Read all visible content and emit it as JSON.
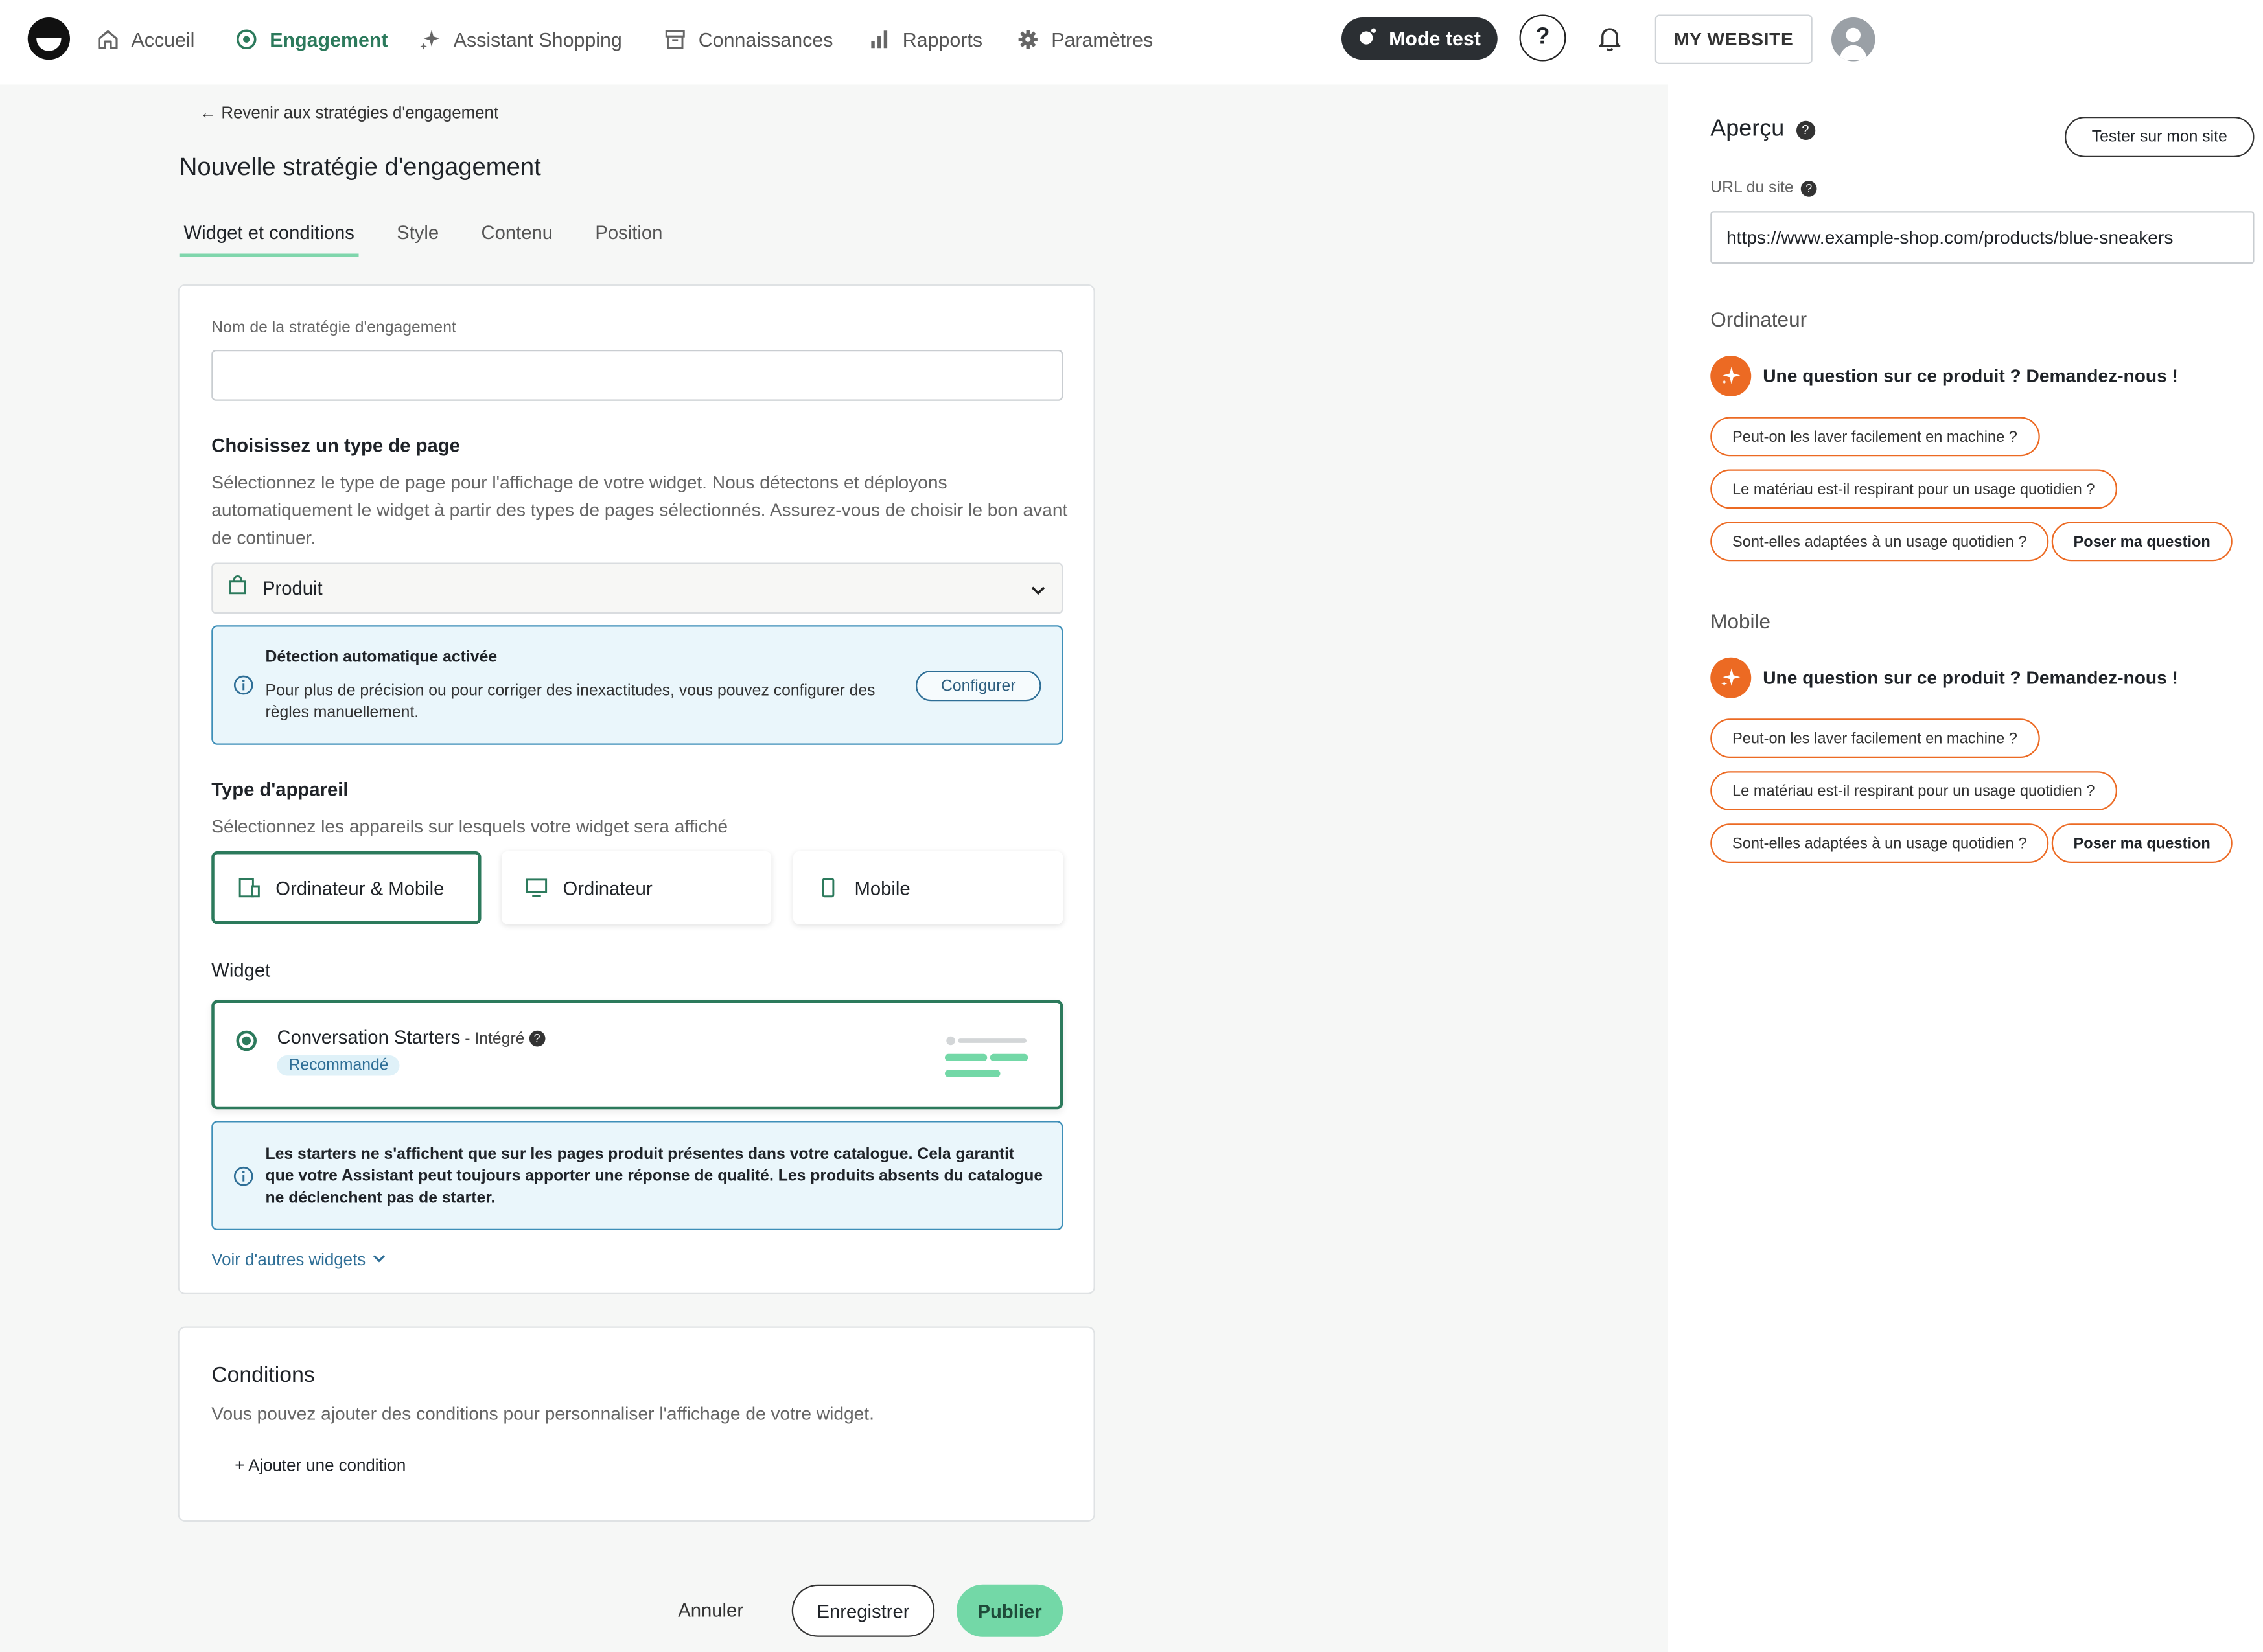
{
  "nav": {
    "items": [
      {
        "label": "Accueil",
        "icon": "home-icon"
      },
      {
        "label": "Engagement",
        "icon": "target-icon",
        "active": true
      },
      {
        "label": "Assistant Shopping",
        "icon": "sparkle-icon"
      },
      {
        "label": "Connaissances",
        "icon": "archive-icon"
      },
      {
        "label": "Rapports",
        "icon": "bar-chart-icon"
      },
      {
        "label": "Paramètres",
        "icon": "gear-icon"
      }
    ],
    "mode_test_label": "Mode test",
    "help_label": "?",
    "website_label": "MY WEBSITE"
  },
  "page": {
    "back_link": "← Revenir aux stratégies d'engagement",
    "title": "Nouvelle stratégie d'engagement",
    "tabs": [
      "Widget et conditions",
      "Style",
      "Contenu",
      "Position"
    ],
    "active_tab": "Widget et conditions"
  },
  "form": {
    "name_label": "Nom de la stratégie d'engagement",
    "name_value": "",
    "page_type_title": "Choisissez un type de page",
    "page_type_desc": "Sélectionnez le type de page pour l'affichage de votre widget. Nous détectons et déployons automatiquement le widget à partir des types de pages sélectionnés. Assurez-vous de choisir le bon avant de continuer.",
    "page_type_value": "Produit",
    "detection_title": "Détection automatique activée",
    "detection_body": "Pour plus de précision ou pour corriger des inexactitudes, vous pouvez configurer des règles manuellement.",
    "configure_label": "Configurer",
    "device_title": "Type d'appareil",
    "device_desc": "Sélectionnez les appareils sur lesquels votre widget sera affiché",
    "devices": [
      {
        "label": "Ordinateur & Mobile",
        "selected": true
      },
      {
        "label": "Ordinateur",
        "selected": false
      },
      {
        "label": "Mobile",
        "selected": false
      }
    ],
    "widget_title": "Widget",
    "widget_name": "Conversation Starters",
    "widget_type": " - Intégré",
    "widget_badge": "Recommandé",
    "starters_info": "Les starters ne s'affichent que sur les pages produit présentes dans votre catalogue. Cela garantit que votre Assistant peut toujours apporter une réponse de qualité. Les produits absents du catalogue ne déclenchent pas de starter.",
    "more_widgets": "Voir d'autres widgets"
  },
  "conditions": {
    "title": "Conditions",
    "desc": "Vous pouvez ajouter des conditions pour personnaliser l'affichage de votre widget.",
    "add_label": "+ Ajouter une condition"
  },
  "footer": {
    "cancel": "Annuler",
    "save": "Enregistrer",
    "publish": "Publier"
  },
  "preview": {
    "title": "Aperçu",
    "test_button": "Tester sur mon site",
    "url_label": "URL du site",
    "url_value": "https://www.example-shop.com/products/blue-sneakers",
    "desktop": {
      "section": "Ordinateur",
      "headline": "Une question sur ce produit ? Demandez-nous !",
      "chips": [
        "Peut-on les laver facilement en machine ?",
        "Le matériau est-il respirant pour un usage quotidien ?",
        "Sont-elles adaptées à un usage quotidien ?",
        "Poser ma question"
      ]
    },
    "mobile": {
      "section": "Mobile",
      "headline": "Une question sur ce produit ? Demandez-nous !",
      "chips": [
        "Peut-on les laver facilement en machine ?",
        "Le matériau est-il respirant pour un usage quotidien ?",
        "Sont-elles adaptées à un usage quotidien ?",
        "Poser ma question"
      ]
    }
  },
  "colors": {
    "accent_green": "#2c7a5c",
    "publish_green": "#73d8a7",
    "info_blue": "#3e8fb8",
    "starter_orange": "#ec6a23"
  }
}
